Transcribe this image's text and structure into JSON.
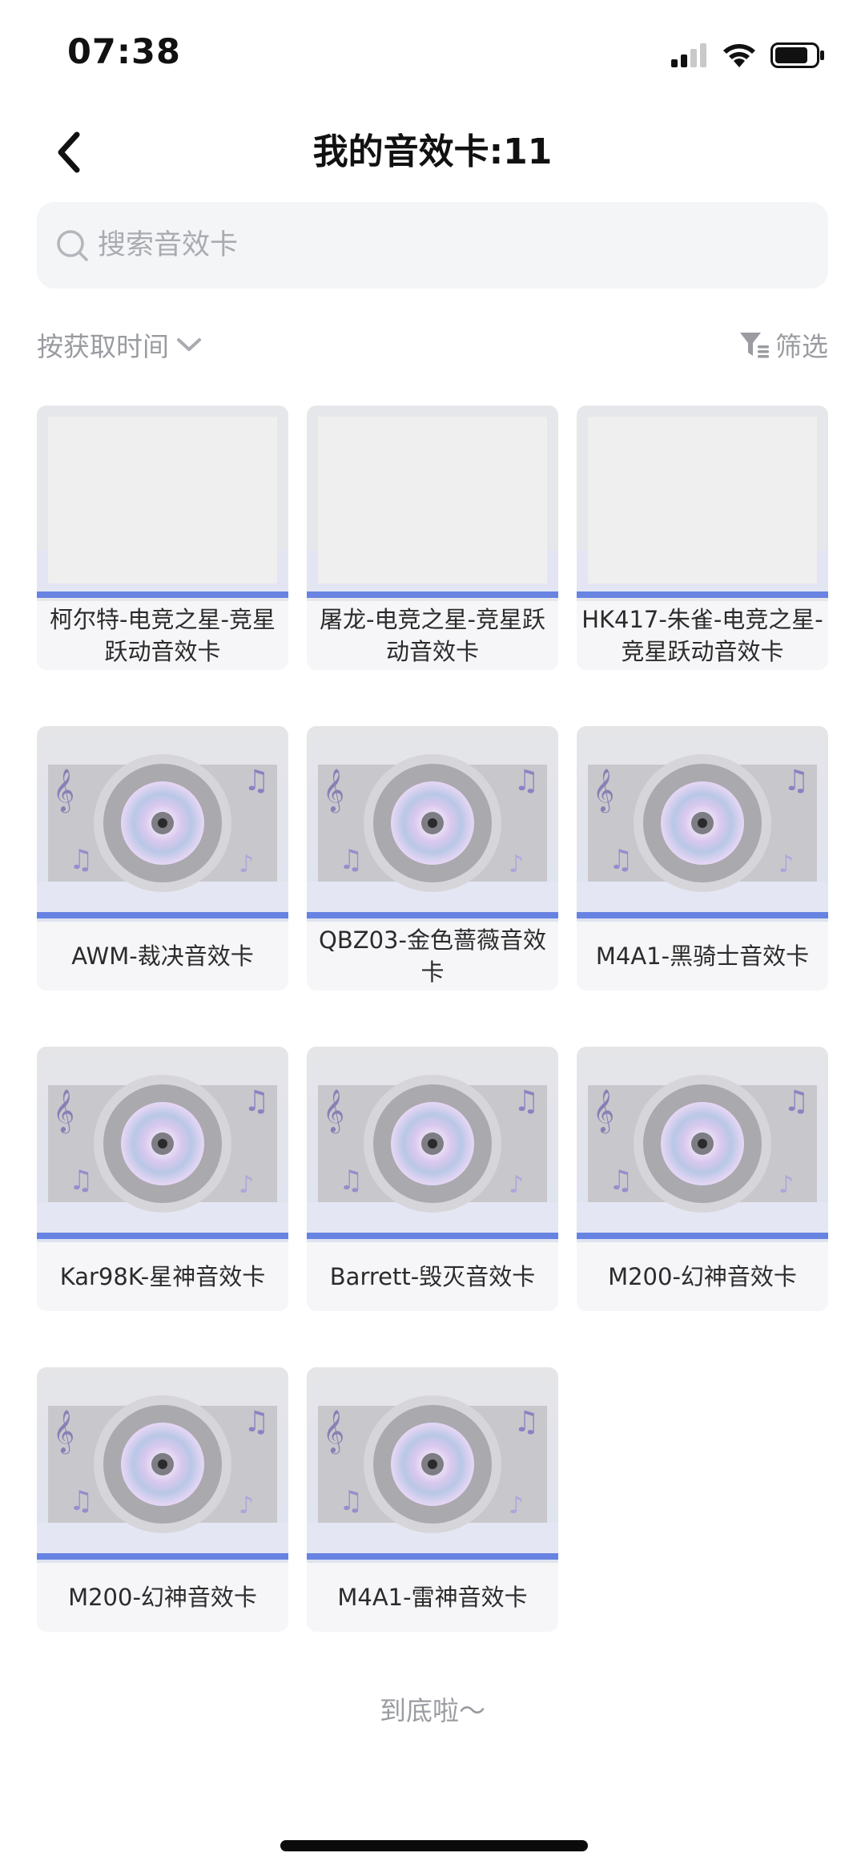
{
  "status_bar": {
    "time": "07:38"
  },
  "header": {
    "title": "我的音效卡:11"
  },
  "search": {
    "placeholder": "搜索音效卡"
  },
  "sort": {
    "label": "按获取时间"
  },
  "filter": {
    "label": "筛选"
  },
  "cards": [
    {
      "name": "柯尔特-电竞之星-竞星跃动音效卡",
      "thumb": "blank"
    },
    {
      "name": "屠龙-电竞之星-竞星跃动音效卡",
      "thumb": "blank"
    },
    {
      "name": "HK417-朱雀-电竞之星-竞星跃动音效卡",
      "thumb": "blank"
    },
    {
      "name": "AWM-裁决音效卡",
      "thumb": "disc"
    },
    {
      "name": "QBZ03-金色蔷薇音效卡",
      "thumb": "disc"
    },
    {
      "name": "M4A1-黑骑士音效卡",
      "thumb": "disc"
    },
    {
      "name": "Kar98K-星神音效卡",
      "thumb": "disc"
    },
    {
      "name": "Barrett-毁灭音效卡",
      "thumb": "disc"
    },
    {
      "name": "M200-幻神音效卡",
      "thumb": "disc"
    },
    {
      "name": "M200-幻神音效卡",
      "thumb": "disc"
    },
    {
      "name": "M4A1-雷神音效卡",
      "thumb": "disc"
    }
  ],
  "footer": {
    "end_text": "到底啦～"
  },
  "colors": {
    "accent_bar": "#5a78e0",
    "muted_text": "#9a9ca1",
    "card_bg": "#f6f6f8"
  },
  "icons": {
    "back": "chevron-left-icon",
    "search": "search-icon",
    "sort": "chevron-down-icon",
    "filter": "filter-icon",
    "signal": "signal-icon",
    "wifi": "wifi-icon",
    "battery": "battery-icon",
    "disc": "cd-disc-icon"
  }
}
